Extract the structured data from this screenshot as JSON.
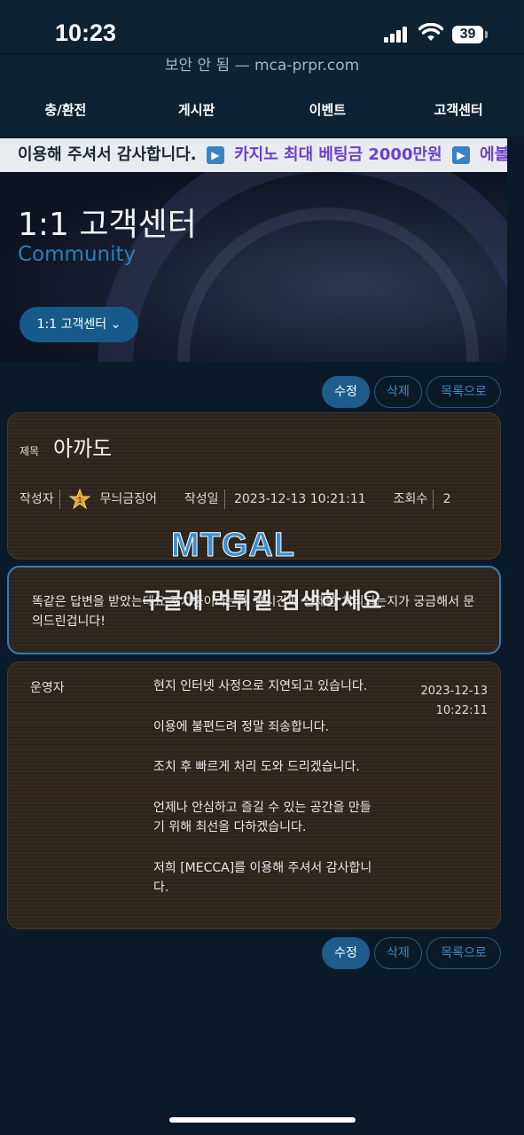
{
  "status": {
    "time": "10:23",
    "battery": "39"
  },
  "browser": {
    "url": "보안 안 됨 — mca-prpr.com"
  },
  "nav": {
    "items": [
      "충/환전",
      "게시판",
      "이벤트",
      "고객센터"
    ]
  },
  "marquee": {
    "text1": "이용해 주셔서 감사합니다.",
    "text2": "카지노 최대 베팅금 2000만원",
    "text3": "에볼루선"
  },
  "banner": {
    "title": "1:1 고객센터",
    "subtitle": "Community",
    "dropdown": "1:1 고객센터"
  },
  "actions": {
    "edit": "수정",
    "delete": "삭제",
    "list": "목록으로"
  },
  "post": {
    "title_label": "제목",
    "title": "아까도",
    "author_label": "작성자",
    "author": "무늬금징어",
    "author_level": "1",
    "date_label": "작성일",
    "date": "2023-12-13 10:21:11",
    "views_label": "조회수",
    "views": "2",
    "body": "똑같은 답변을 받았는데요 조치중이라는데 몇시간째 언제쯤 처리되는지가 궁금해서 문의드린겁니다!"
  },
  "reply": {
    "author": "운영자",
    "paragraphs": [
      "현지 인터넷 사정으로 지연되고 있습니다.",
      "이용에 불편드려 정말 죄송합니다.",
      "조치 후 빠르게 처리 도와 드리겠습니다.",
      "언제나 안심하고 즐길 수 있는 공간을 만들기 위해 최선을 다하겠습니다.",
      "저희 [MECCA]를 이용해 주셔서 감사합니다."
    ],
    "date": "2023-12-13",
    "time": "10:22:11"
  },
  "watermark": {
    "logo": "MTGAL",
    "text": "구글에 먹튀갤 검색하세요"
  },
  "colors": {
    "accent": "#1d5c8c",
    "background": "#0b1a28",
    "card": "#33291f"
  }
}
